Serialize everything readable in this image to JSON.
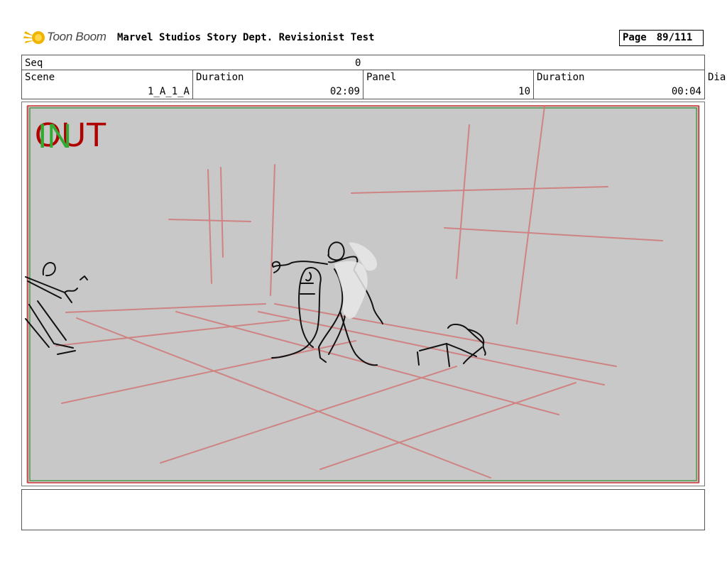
{
  "header": {
    "logo_text": "Toon Boom",
    "document_title": "Marvel Studios Story Dept. Revisionist Test",
    "page_label": "Page",
    "page_value": "89/111"
  },
  "info": {
    "seq_label": "Seq",
    "seq_value": "0",
    "scene_label": "Scene",
    "scene_value": "1_A_1_A",
    "duration_label": "Duration",
    "scene_duration": "02:09",
    "panel_label": "Panel",
    "panel_value": "10",
    "panel_duration_label": "Duration",
    "panel_duration": "00:04",
    "dialogue_label": "Dia"
  },
  "panel": {
    "out_label": "OUT",
    "in_label": "IN",
    "colors": {
      "background": "#c8c8c8",
      "frame_red": "#cc3333",
      "frame_green": "#2e8b2e",
      "guide_lines": "#d07c7c",
      "out_text": "#b00000",
      "in_text": "#33aa33"
    }
  },
  "notes": {
    "text": ""
  }
}
